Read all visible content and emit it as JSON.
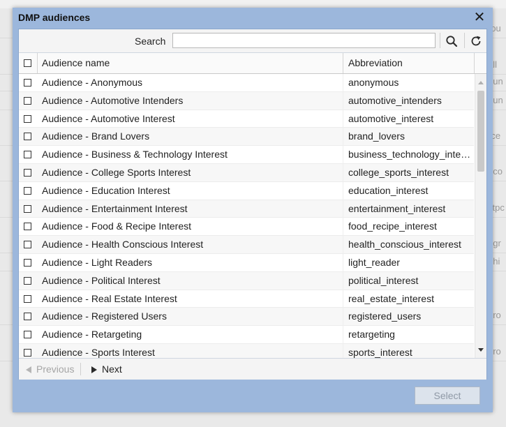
{
  "dialog": {
    "title": "DMP audiences",
    "close_glyph": "✕"
  },
  "toolbar": {
    "search_label": "Search",
    "search_value": "",
    "search_icon": "search-icon",
    "refresh_icon": "refresh-icon"
  },
  "grid": {
    "columns": [
      "Audience name",
      "Abbreviation"
    ],
    "rows": [
      {
        "name": "Audience - Anonymous",
        "abbr": "anonymous"
      },
      {
        "name": "Audience - Automotive Intenders",
        "abbr": "automotive_intenders"
      },
      {
        "name": "Audience - Automotive Interest",
        "abbr": "automotive_interest"
      },
      {
        "name": "Audience - Brand Lovers",
        "abbr": "brand_lovers"
      },
      {
        "name": "Audience - Business & Technology Interest",
        "abbr": "business_technology_interest"
      },
      {
        "name": "Audience - College Sports Interest",
        "abbr": "college_sports_interest"
      },
      {
        "name": "Audience - Education Interest",
        "abbr": "education_interest"
      },
      {
        "name": "Audience - Entertainment Interest",
        "abbr": "entertainment_interest"
      },
      {
        "name": "Audience - Food & Recipe Interest",
        "abbr": "food_recipe_interest"
      },
      {
        "name": "Audience - Health Conscious Interest",
        "abbr": "health_conscious_interest"
      },
      {
        "name": "Audience - Light Readers",
        "abbr": "light_reader"
      },
      {
        "name": "Audience - Political Interest",
        "abbr": "political_interest"
      },
      {
        "name": "Audience - Real Estate Interest",
        "abbr": "real_estate_interest"
      },
      {
        "name": "Audience - Registered Users",
        "abbr": "registered_users"
      },
      {
        "name": "Audience - Retargeting",
        "abbr": "retargeting"
      },
      {
        "name": "Audience - Sports Interest",
        "abbr": "sports_interest"
      }
    ]
  },
  "pager": {
    "previous_label": "Previous",
    "next_label": "Next"
  },
  "footer": {
    "select_label": "Select"
  },
  "background": {
    "fragments": [
      "rou",
      "all",
      "oun",
      "oun",
      "rce",
      "nco",
      "stpc",
      "dgr",
      "ohi",
      "gro",
      "gro"
    ]
  }
}
